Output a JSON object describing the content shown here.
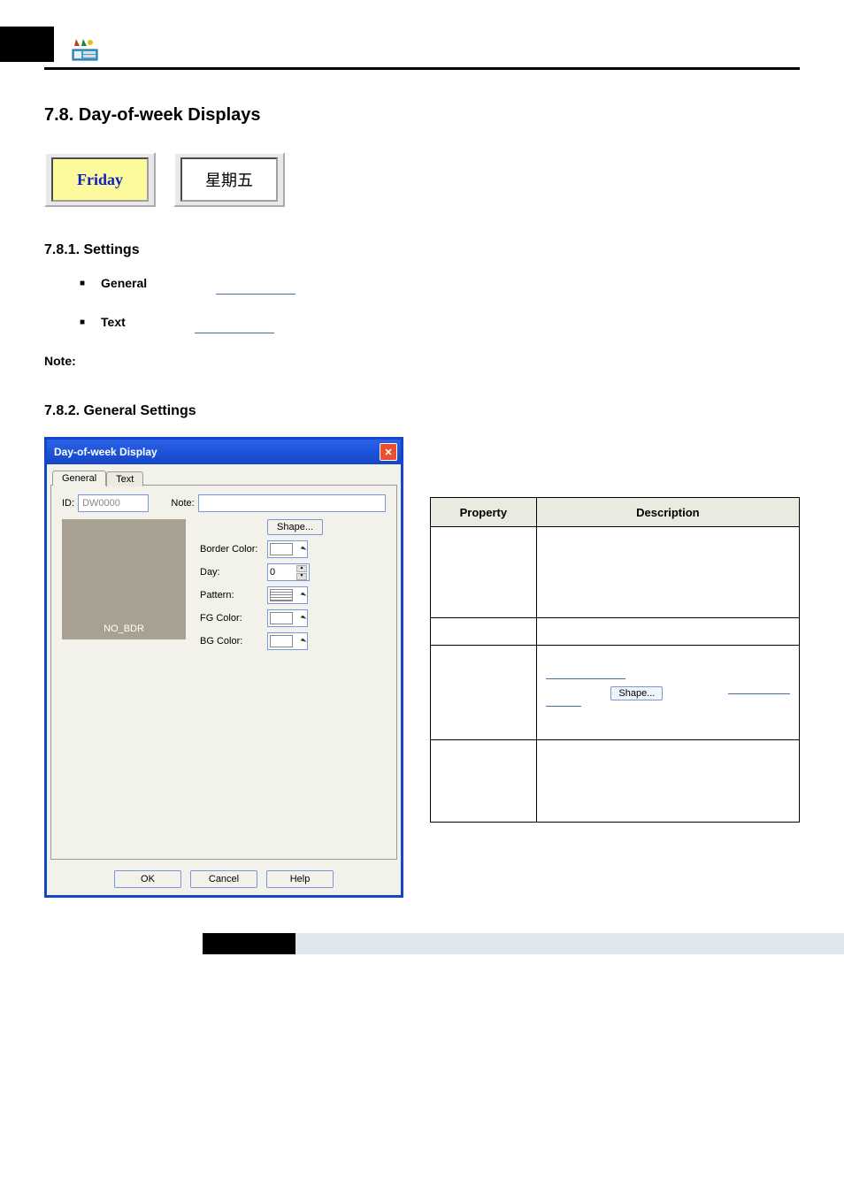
{
  "header": {},
  "section": {
    "title": "7.8. Day-of-week Displays",
    "sub1": "7.8.1. Settings",
    "sub2": "7.8.2. General Settings"
  },
  "examples": {
    "friday": "Friday",
    "cjk": "星期五"
  },
  "bullets": {
    "general": "General",
    "text": "Text"
  },
  "note_label": "Note:",
  "dialog": {
    "title": "Day-of-week Display",
    "tabs": {
      "general": "General",
      "text": "Text"
    },
    "id_label": "ID:",
    "id_value": "DW0000",
    "note_label": "Note:",
    "note_value": "",
    "shape_btn": "Shape...",
    "border_label": "Border Color:",
    "day_label": "Day:",
    "day_value": "0",
    "pattern_label": "Pattern:",
    "fg_label": "FG Color:",
    "bg_label": "BG Color:",
    "preview_text": "NO_BDR",
    "ok": "OK",
    "cancel": "Cancel",
    "help": "Help"
  },
  "table": {
    "prop_header": "Property",
    "desc_header": "Description",
    "shape_mini": "Shape..."
  }
}
